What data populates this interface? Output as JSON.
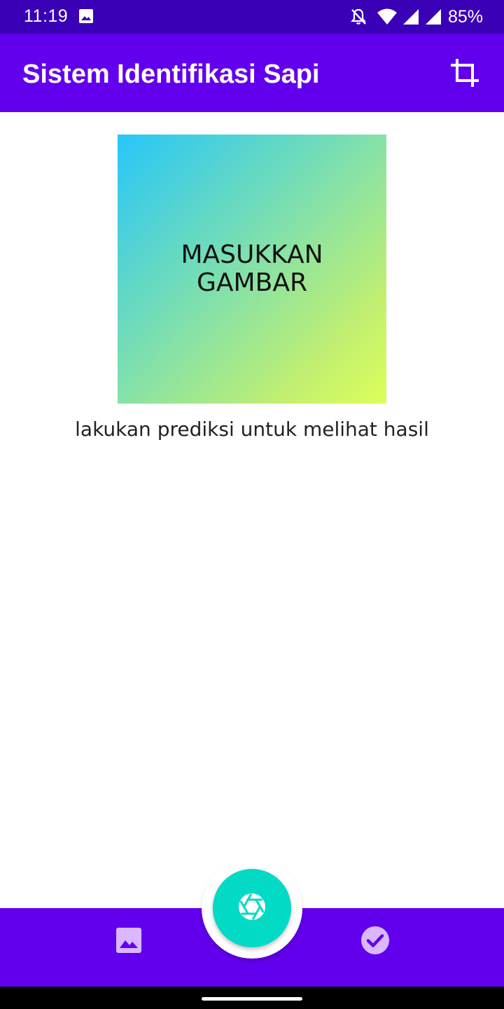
{
  "status_bar": {
    "time": "11:19",
    "battery": "85%",
    "icons": [
      "image-notification-icon",
      "bell-off-icon",
      "wifi-icon",
      "cell-signal-icon",
      "cell-signal-icon",
      "battery-icon"
    ]
  },
  "app_bar": {
    "title": "Sistem Identifikasi Sapi",
    "action_icon": "crop-icon"
  },
  "main": {
    "image_placeholder_text": "MASUKKAN\nGAMBAR",
    "result_text": "lakukan prediksi untuk melihat hasil"
  },
  "bottom_bar": {
    "left_icon": "gallery-icon",
    "fab_icon": "camera-shutter-icon",
    "right_icon": "check-circle-icon"
  },
  "colors": {
    "status_bar": "#3a00b5",
    "primary": "#6200ee",
    "fab": "#03dac5",
    "bottom_icons": "#d9b8ff"
  }
}
